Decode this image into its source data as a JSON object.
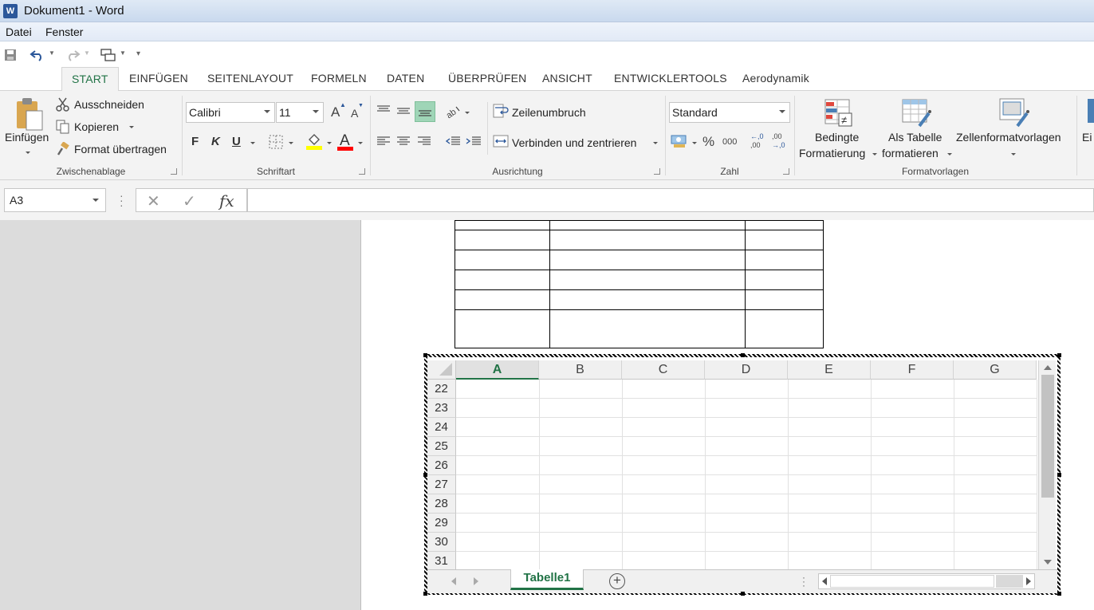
{
  "window": {
    "title": "Dokument1 - Word",
    "app_icon": "W"
  },
  "menu": {
    "items": [
      "Datei",
      "Fenster"
    ]
  },
  "qat": {
    "customize_glyph": "▾"
  },
  "tabs": [
    "START",
    "EINFÜGEN",
    "SEITENLAYOUT",
    "FORMELN",
    "DATEN",
    "ÜBERPRÜFEN",
    "ANSICHT",
    "ENTWICKLERTOOLS",
    "Aerodynamik"
  ],
  "ribbon": {
    "clipboard": {
      "paste": "Einfügen",
      "cut": "Ausschneiden",
      "copy": "Kopieren",
      "format_painter": "Format übertragen",
      "label": "Zwischenablage"
    },
    "font": {
      "name": "Calibri",
      "size": "11",
      "bold": "F",
      "italic": "K",
      "underline": "U",
      "grow": "A",
      "shrink": "A",
      "color_a": "A",
      "label": "Schriftart",
      "highlight_color": "#ffff00",
      "font_color": "#ff0000"
    },
    "alignment": {
      "wrap": "Zeilenumbruch",
      "merge": "Verbinden und zentrieren",
      "label": "Ausrichtung"
    },
    "number": {
      "format": "Standard",
      "percent": "%",
      "thousands": "000",
      "inc_top": "←,0",
      "inc_bottom": ",00",
      "dec_top": ",00",
      "dec_bottom": "→,0",
      "label": "Zahl"
    },
    "styles": {
      "conditional_1": "Bedingte",
      "conditional_2": "Formatierung",
      "table_1": "Als Tabelle",
      "table_2": "formatieren",
      "cell_styles": "Zellenformatvorlagen",
      "label": "Formatvorlagen"
    },
    "cells": {
      "insert_truncated": "Ei"
    }
  },
  "formula_bar": {
    "name_box": "A3",
    "cancel": "✕",
    "enter": "✓",
    "fx": "fx",
    "value": ""
  },
  "excel": {
    "columns": [
      "A",
      "B",
      "C",
      "D",
      "E",
      "F",
      "G"
    ],
    "selected_column": "A",
    "rows": [
      "22",
      "23",
      "24",
      "25",
      "26",
      "27",
      "28",
      "29",
      "30",
      "31"
    ],
    "sheet_tab": "Tabelle1",
    "add_sheet": "+",
    "sheet_accent": "#217346"
  }
}
